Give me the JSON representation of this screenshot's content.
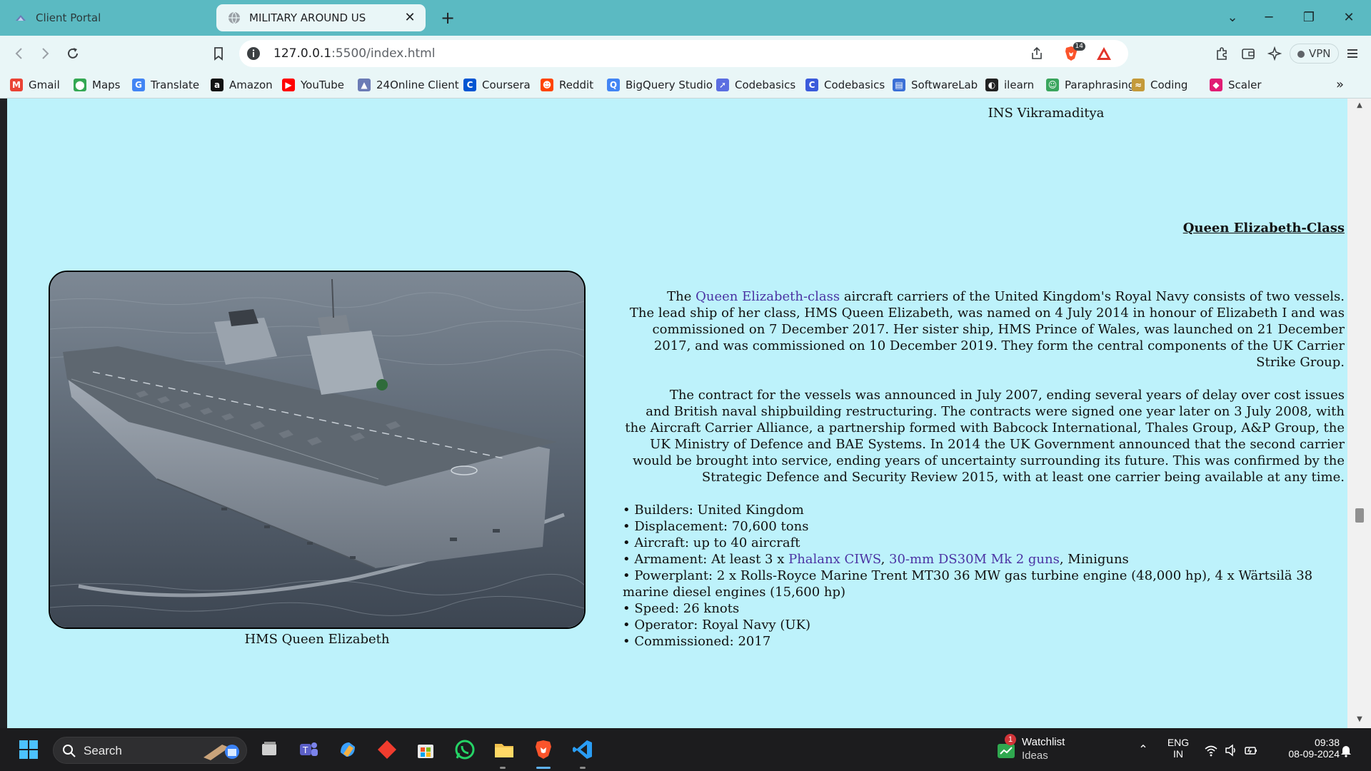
{
  "browser": {
    "tabs": [
      {
        "title": "Client Portal",
        "active": false
      },
      {
        "title": "MILITARY AROUND US",
        "active": true
      }
    ],
    "tab_close": "✕",
    "new_tab": "+",
    "window_controls": {
      "chevron": "⌄",
      "minimize": "─",
      "restore": "❐",
      "close": "✕"
    },
    "url_host": "127.0.0.1",
    "url_rest": ":5500/index.html",
    "brave_count": "14",
    "vpn_label": "VPN",
    "bookmarks": [
      {
        "label": "Gmail",
        "icon": "gmail-icon",
        "color": "#ea4335",
        "glyph": "M"
      },
      {
        "label": "Maps",
        "icon": "maps-icon",
        "color": "#34a853",
        "glyph": "⬤"
      },
      {
        "label": "Translate",
        "icon": "translate-icon",
        "color": "#4285f4",
        "glyph": "G"
      },
      {
        "label": "Amazon",
        "icon": "amazon-icon",
        "color": "#111111",
        "glyph": "a"
      },
      {
        "label": "YouTube",
        "icon": "youtube-icon",
        "color": "#ff0000",
        "glyph": "▶"
      },
      {
        "label": "24Online Client",
        "icon": "online-client-icon",
        "color": "#6b7bb5",
        "glyph": "▲"
      },
      {
        "label": "Coursera",
        "icon": "coursera-icon",
        "color": "#0056d2",
        "glyph": "C"
      },
      {
        "label": "Reddit",
        "icon": "reddit-icon",
        "color": "#ff4500",
        "glyph": "☻"
      },
      {
        "label": "BigQuery Studio",
        "icon": "bigquery-icon",
        "color": "#4285f4",
        "glyph": "Q"
      },
      {
        "label": "Codebasics",
        "icon": "rocket-icon",
        "color": "#5b6ee1",
        "glyph": "➚"
      },
      {
        "label": "Codebasics",
        "icon": "codebasics-icon",
        "color": "#3b5bdb",
        "glyph": "C"
      },
      {
        "label": "SoftwareLab",
        "icon": "softwarelab-icon",
        "color": "#3b6fd6",
        "glyph": "▤"
      },
      {
        "label": "ilearn",
        "icon": "ilearn-icon",
        "color": "#222222",
        "glyph": "◐"
      },
      {
        "label": "Paraphrasing",
        "icon": "paraphrasing-icon",
        "color": "#3aa55d",
        "glyph": "☺"
      },
      {
        "label": "Coding",
        "icon": "coding-icon",
        "color": "#c49a3a",
        "glyph": "≈"
      },
      {
        "label": "Scaler",
        "icon": "scaler-icon",
        "color": "#e11d74",
        "glyph": "◆"
      }
    ],
    "bookmarks_more": "»"
  },
  "page": {
    "prev_caption": "INS Vikramaditya",
    "section_title": "Queen Elizabeth-Class",
    "image_caption": "HMS Queen Elizabeth",
    "p1_lead": "The ",
    "p1_link": "Queen Elizabeth-class",
    "p1_rest": " aircraft carriers of the United Kingdom's Royal Navy consists of two vessels. The lead ship of her class, HMS Queen Elizabeth, was named on 4 July 2014 in honour of Elizabeth I and was commissioned on 7 December 2017. Her sister ship, HMS Prince of Wales, was launched on 21 December 2017, and was commissioned on 10 December 2019. They form the central components of the UK Carrier Strike Group.",
    "p2": "The contract for the vessels was announced in July 2007, ending several years of delay over cost issues and British naval shipbuilding restructuring. The contracts were signed one year later on 3 July 2008, with the Aircraft Carrier Alliance, a partnership formed with Babcock International, Thales Group, A&P Group, the UK Ministry of Defence and BAE Systems. In 2014 the UK Government announced that the second carrier would be brought into service, ending years of uncertainty surrounding its future. This was confirmed by the Strategic Defence and Security Review 2015, with at least one carrier being available at any time.",
    "specs": {
      "builders": "• Builders: United Kingdom",
      "displacement": "• Displacement: 70,600 tons",
      "aircraft": "• Aircraft: up to 40 aircraft",
      "armament_lead": "• Armament: At least 3 x ",
      "armament_link1": "Phalanx CIWS",
      "armament_sep": ", ",
      "armament_link2": "30-mm DS30M Mk 2 guns",
      "armament_rest": ", Miniguns",
      "powerplant": "• Powerplant: 2 x Rolls-Royce Marine Trent MT30 36 MW gas turbine engine (48,000 hp), 4 x Wärtsilä 38 marine diesel engines (15,600 hp)",
      "speed": "• Speed: 26 knots",
      "operator": "• Operator: Royal Navy (UK)",
      "commissioned": "• Commissioned: 2017"
    }
  },
  "taskbar": {
    "search_label": "Search",
    "watchlist_title": "Watchlist",
    "watchlist_sub": "Ideas",
    "watchlist_badge": "1",
    "lang": "ENG",
    "region": "IN",
    "time": "09:38",
    "date": "08-09-2024"
  },
  "colors": {
    "tabstrip": "#5bbac2",
    "toolbar": "#e9f6f7",
    "page_bg": "#bdf2fb",
    "link": "#4b33a3",
    "taskbar": "#1c1c1e"
  }
}
